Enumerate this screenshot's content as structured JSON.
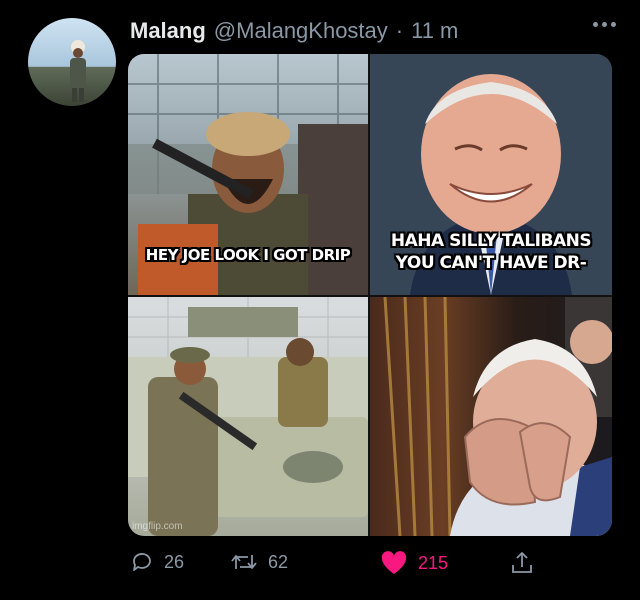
{
  "author": {
    "display_name": "Malang",
    "handle": "@MalangKhostay",
    "separator": "·",
    "time": "11 m"
  },
  "media": {
    "caption_top_left": "HEY JOE LOOK I GOT DRIP",
    "caption_top_right": "HAHA SILLY TALIBANS\nYOU CAN'T HAVE DR-",
    "watermark": "imgflip.com"
  },
  "stats": {
    "replies": "26",
    "retweets": "62",
    "likes": "215"
  },
  "icons": {
    "reply": "reply-icon",
    "retweet": "retweet-icon",
    "like": "heart-icon",
    "share": "share-icon",
    "more": "more-options-icon"
  },
  "colors": {
    "background": "#000000",
    "secondary_text": "#8b98a5",
    "like_active": "#f91880"
  }
}
